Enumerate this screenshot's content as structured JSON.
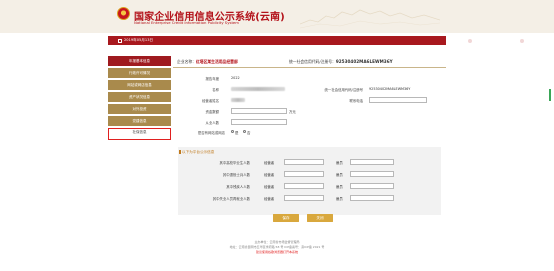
{
  "header": {
    "title": "国家企业信用信息公示系统(云南)",
    "subtitle": "National Enterprise Credit Information Publicity System"
  },
  "topbar": {
    "date": "2019年05月13日",
    "link_help": "年度报告填报指南",
    "link_exit": "退出登录"
  },
  "sidebar": {
    "items": [
      {
        "label": "年报基本信息"
      },
      {
        "label": "行政许可情况"
      },
      {
        "label": "网站或网店信息"
      },
      {
        "label": "资产状况信息"
      },
      {
        "label": "对外投资"
      },
      {
        "label": "党建信息"
      },
      {
        "label": "社保信息"
      }
    ]
  },
  "entity": {
    "name_label": "企业名称：",
    "name_value": "红塔区某生活用品经营部",
    "code_label": "统一社会信用代码/注册号：",
    "code_value": "92530402MA6LEWM36Y"
  },
  "form": {
    "year_label": "报告年度",
    "year_value": "2022",
    "name_label": "名称",
    "credit_code_label": "统一社会信用代码/注册号",
    "credit_code_value": "92530402MA6LEWM36Y",
    "operator_label": "经营者姓名",
    "phone_label": "联系电话",
    "funds_label": "资金数额",
    "funds_unit": "万元",
    "employees_label": "从业人数",
    "public_label": "是否有网站或网店",
    "radio_yes": "是",
    "radio_no": "否"
  },
  "section": {
    "title": "以下为平台公示信息",
    "rows": [
      {
        "label": "其中高校毕业生人数",
        "sub1": "经营者",
        "sub2": "雇员"
      },
      {
        "label": "其中退役士兵人数",
        "sub1": "经营者",
        "sub2": "雇员"
      },
      {
        "label": "其中残疾人人数",
        "sub1": "经营者",
        "sub2": "雇员"
      },
      {
        "label": "其中失业人员再就业人数",
        "sub1": "经营者",
        "sub2": "雇员"
      }
    ]
  },
  "buttons": {
    "save": "保存",
    "cancel": "关闭"
  },
  "footer": {
    "line1": "主办单位：云南省市场监督管理局",
    "line2": "地址：云南省昆明市五华区学府路 58 号 ICP备案号：滇ICP备 2021 号",
    "line3": "建议使用谷歌浏览器打开本系统"
  },
  "colors": {
    "brand_red": "#a8181e",
    "sidebar_gold": "#a98a4c",
    "button_gold": "#d9a83d",
    "highlight_border": "#e02020"
  }
}
